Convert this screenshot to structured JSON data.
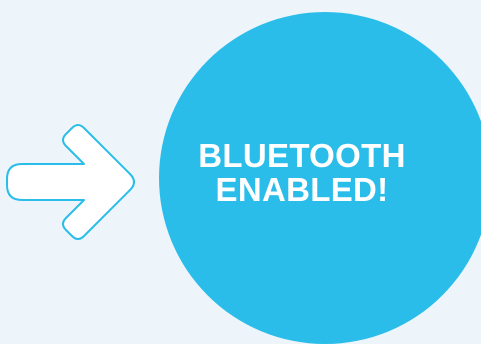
{
  "badge": {
    "line1": "BLUETOOTH",
    "line2": "ENABLED!",
    "color": "#2bbdea",
    "text_color": "#ffffff"
  },
  "arrow": {
    "icon": "arrow-right-icon",
    "stroke_color": "#2bbdea",
    "fill_color": "#ffffff"
  },
  "background_color": "#edf5fb"
}
